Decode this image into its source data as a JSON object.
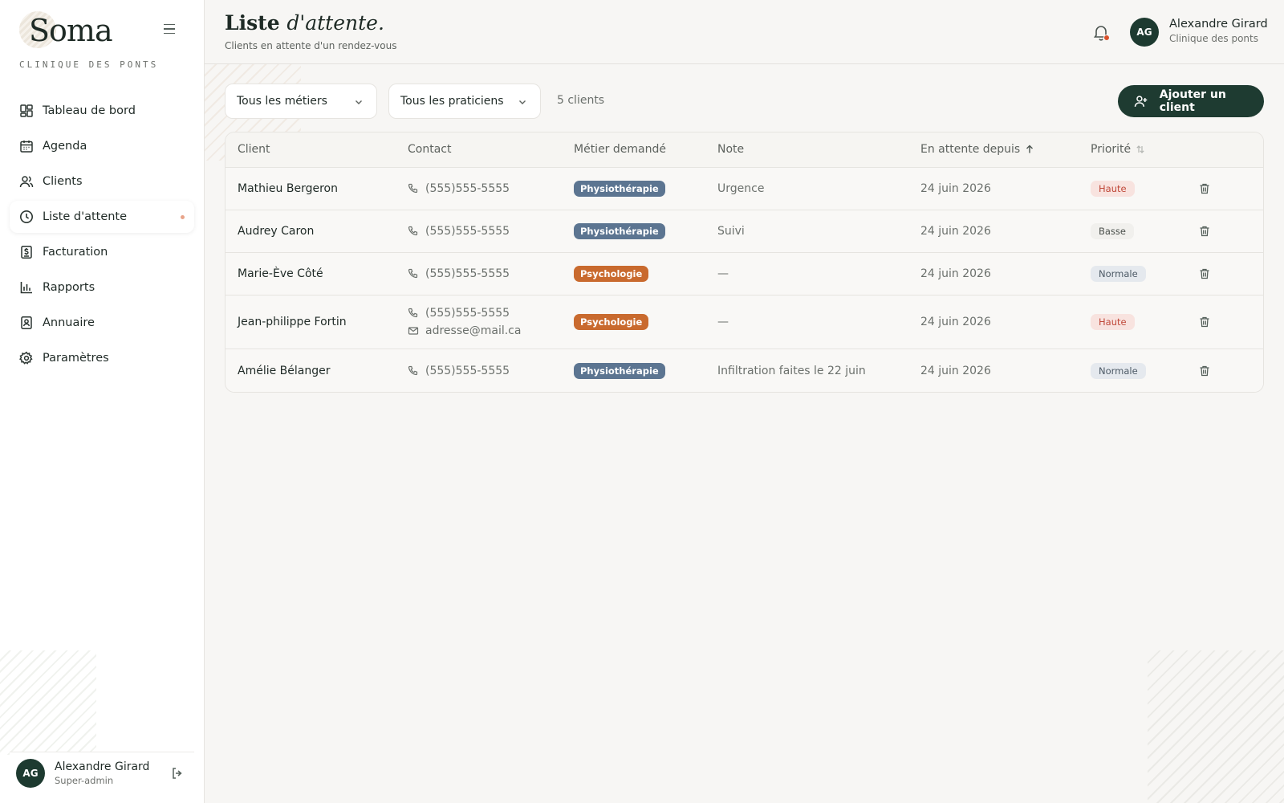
{
  "brand": {
    "name": "Soma",
    "subtitle": "CLINIQUE DES PONTS"
  },
  "sidebar": {
    "items": [
      {
        "label": "Tableau de bord",
        "icon": "dashboard-icon"
      },
      {
        "label": "Agenda",
        "icon": "calendar-icon"
      },
      {
        "label": "Clients",
        "icon": "users-icon"
      },
      {
        "label": "Liste d'attente",
        "icon": "clock-icon",
        "active": true
      },
      {
        "label": "Facturation",
        "icon": "invoice-icon"
      },
      {
        "label": "Rapports",
        "icon": "bar-chart-icon"
      },
      {
        "label": "Annuaire",
        "icon": "contact-book-icon"
      },
      {
        "label": "Paramètres",
        "icon": "gear-icon"
      }
    ],
    "user": {
      "initials": "AG",
      "name": "Alexandre Girard",
      "role": "Super-admin"
    }
  },
  "header": {
    "title_main": "Liste",
    "title_italic": "d'attente.",
    "subtitle": "Clients en attente d'un rendez-vous",
    "user": {
      "initials": "AG",
      "name": "Alexandre Girard",
      "clinic": "Clinique des ponts"
    }
  },
  "toolbar": {
    "filter_trades": "Tous les métiers",
    "filter_practitioners": "Tous les praticiens",
    "count": "5 clients",
    "add_label": "Ajouter un client"
  },
  "table": {
    "headers": {
      "client": "Client",
      "contact": "Contact",
      "trade": "Métier demandé",
      "note": "Note",
      "waiting": "En attente depuis",
      "priority": "Priorité"
    },
    "rows": [
      {
        "name": "Mathieu Bergeron",
        "phone": "(555)555-5555",
        "email": null,
        "trade": "Physiothérapie",
        "note": "Urgence",
        "date": "24 juin 2026",
        "priority": "Haute"
      },
      {
        "name": "Audrey Caron",
        "phone": "(555)555-5555",
        "email": null,
        "trade": "Physiothérapie",
        "note": "Suivi",
        "date": "24 juin 2026",
        "priority": "Basse"
      },
      {
        "name": "Marie-Ève Côté",
        "phone": "(555)555-5555",
        "email": null,
        "trade": "Psychologie",
        "note": "—",
        "date": "24 juin 2026",
        "priority": "Normale"
      },
      {
        "name": "Jean-philippe Fortin",
        "phone": "(555)555-5555",
        "email": "adresse@mail.ca",
        "trade": "Psychologie",
        "note": "—",
        "date": "24 juin 2026",
        "priority": "Haute"
      },
      {
        "name": "Amélie Bélanger",
        "phone": "(555)555-5555",
        "email": null,
        "trade": "Physiothérapie",
        "note": "Infiltration faites le 22 juin",
        "date": "24 juin 2026",
        "priority": "Normale"
      }
    ]
  },
  "colors": {
    "accent": "#1e3b31",
    "physio_tag": "#5c7591",
    "psycho_tag": "#c96a2e",
    "prio_haute_bg": "#f8e3df",
    "prio_haute_text": "#c0493a",
    "prio_basse_bg": "#f1f0ed",
    "prio_basse_text": "#4a4f4b",
    "prio_normale_bg": "#e5e9ee",
    "prio_normale_text": "#4d5a66"
  }
}
